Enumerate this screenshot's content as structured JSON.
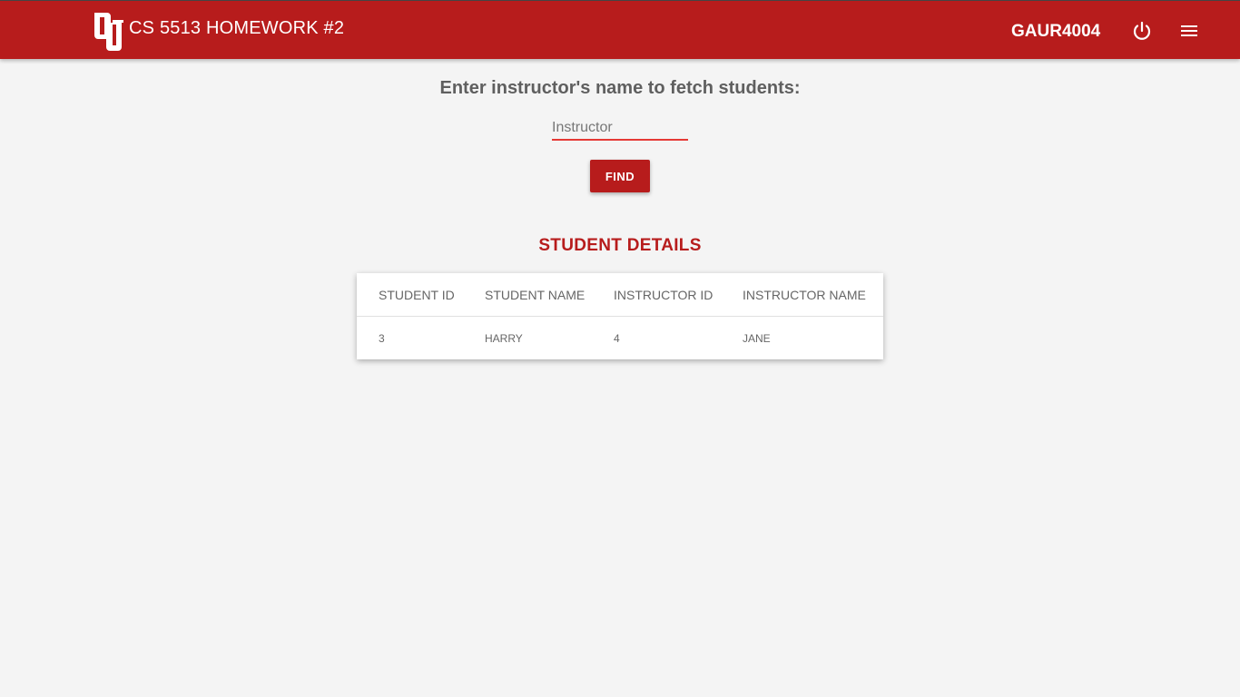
{
  "header": {
    "title": "CS 5513 HOMEWORK #2",
    "username": "GAUR4004",
    "logo_icon": "ou-logo-icon",
    "power_icon": "power-icon",
    "menu_icon": "hamburger-menu-icon"
  },
  "search": {
    "prompt": "Enter instructor's name to fetch students:",
    "placeholder": "Instructor",
    "value": "",
    "button_label": "FIND"
  },
  "results": {
    "title": "STUDENT DETAILS",
    "columns": [
      "STUDENT ID",
      "STUDENT NAME",
      "INSTRUCTOR ID",
      "INSTRUCTOR NAME"
    ],
    "rows": [
      [
        "3",
        "HARRY",
        "4",
        "JANE"
      ]
    ]
  },
  "colors": {
    "brand": "#b71c1c",
    "background": "#f4f4f4",
    "input_underline": "#e53935"
  }
}
